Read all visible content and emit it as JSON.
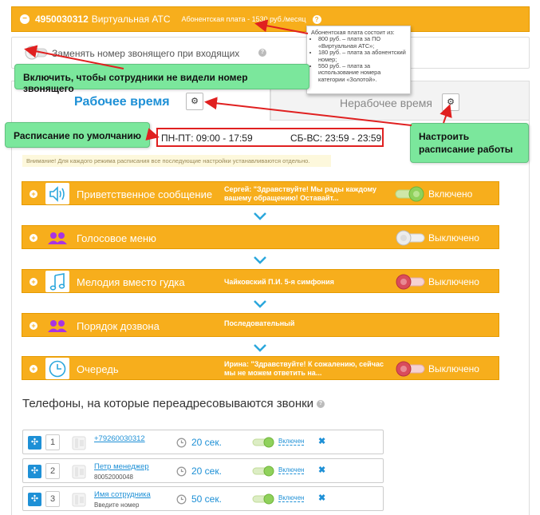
{
  "header": {
    "collapse_glyph": "−",
    "number": "4950030312",
    "service": "Виртуальная АТС",
    "fee": "Абонентская плата - 1530 руб./месяц",
    "help_glyph": "?"
  },
  "tooltip": {
    "title": "Абонентская плата состоит из:",
    "items": [
      "800 руб. – плата за ПО «Виртуальная АТС»;",
      "180 руб. – плата за абонентский номер;",
      "550 руб. – плата за использование номера категории «Золотой»."
    ]
  },
  "hide_caller": {
    "label": "Заменять номер звонящего при входящих",
    "help_glyph": "?"
  },
  "notes": {
    "hide": "Включить, чтобы сотрудники не видели номер звонящего",
    "default_schedule": "Расписание по умолчанию",
    "configure": "Настроить расписание работы"
  },
  "tabs": {
    "work": "Рабочее время",
    "off": "Нерабочее время",
    "gear_glyph": "⚙"
  },
  "schedule": {
    "weekdays": "ПН-ПТ: 09:00 - 17:59",
    "weekend": "СБ-ВС: 23:59 - 23:59"
  },
  "warning": "Внимание! Для каждого режима расписания все последующие настройки устанавливаются отдельно.",
  "options": [
    {
      "icon": "speaker-icon",
      "title": "Приветственное сообщение",
      "desc": "Сергей: \"Здравствуйте! Мы рады каждому вашему обращению! Оставайт...",
      "state": "Включено",
      "on": true
    },
    {
      "icon": "users-icon",
      "title": "Голосовое меню",
      "desc": "",
      "state": "Выключено",
      "on": false
    },
    {
      "icon": "music-note-icon",
      "title": "Мелодия вместо гудка",
      "desc": "Чайковский П.И. 5-я симфония",
      "state": "Выключено",
      "on": false
    },
    {
      "icon": "users-icon",
      "title": "Порядок дозвона",
      "desc": "Последовательный",
      "state": "",
      "on": null
    },
    {
      "icon": "clock-icon",
      "title": "Очередь",
      "desc": "Ирина: \"Здравствуйте! К сожалению, сейчас мы не можем ответить на...",
      "state": "Выключено",
      "on": false
    }
  ],
  "expand_glyph": "+",
  "phones": {
    "title": "Телефоны, на которые переадресовываются звонки",
    "help_glyph": "?",
    "move_glyph": "✣",
    "delete_glyph": "✖",
    "rows": [
      {
        "order": "1",
        "name": "+79260030312",
        "sub": "",
        "timeout": "20 сек.",
        "state": "Включен"
      },
      {
        "order": "2",
        "name": "Петр менеджер",
        "sub": "80052000048",
        "timeout": "20 сек.",
        "state": "Включен"
      },
      {
        "order": "3",
        "name": "Имя сотрудника",
        "sub": "Введите номер",
        "timeout": "50 сек.",
        "state": "Включен"
      }
    ]
  },
  "colors": {
    "accent": "#f7ae1c",
    "link": "#1e90d6",
    "note": "#7be79c",
    "arrow": "#e02020"
  }
}
